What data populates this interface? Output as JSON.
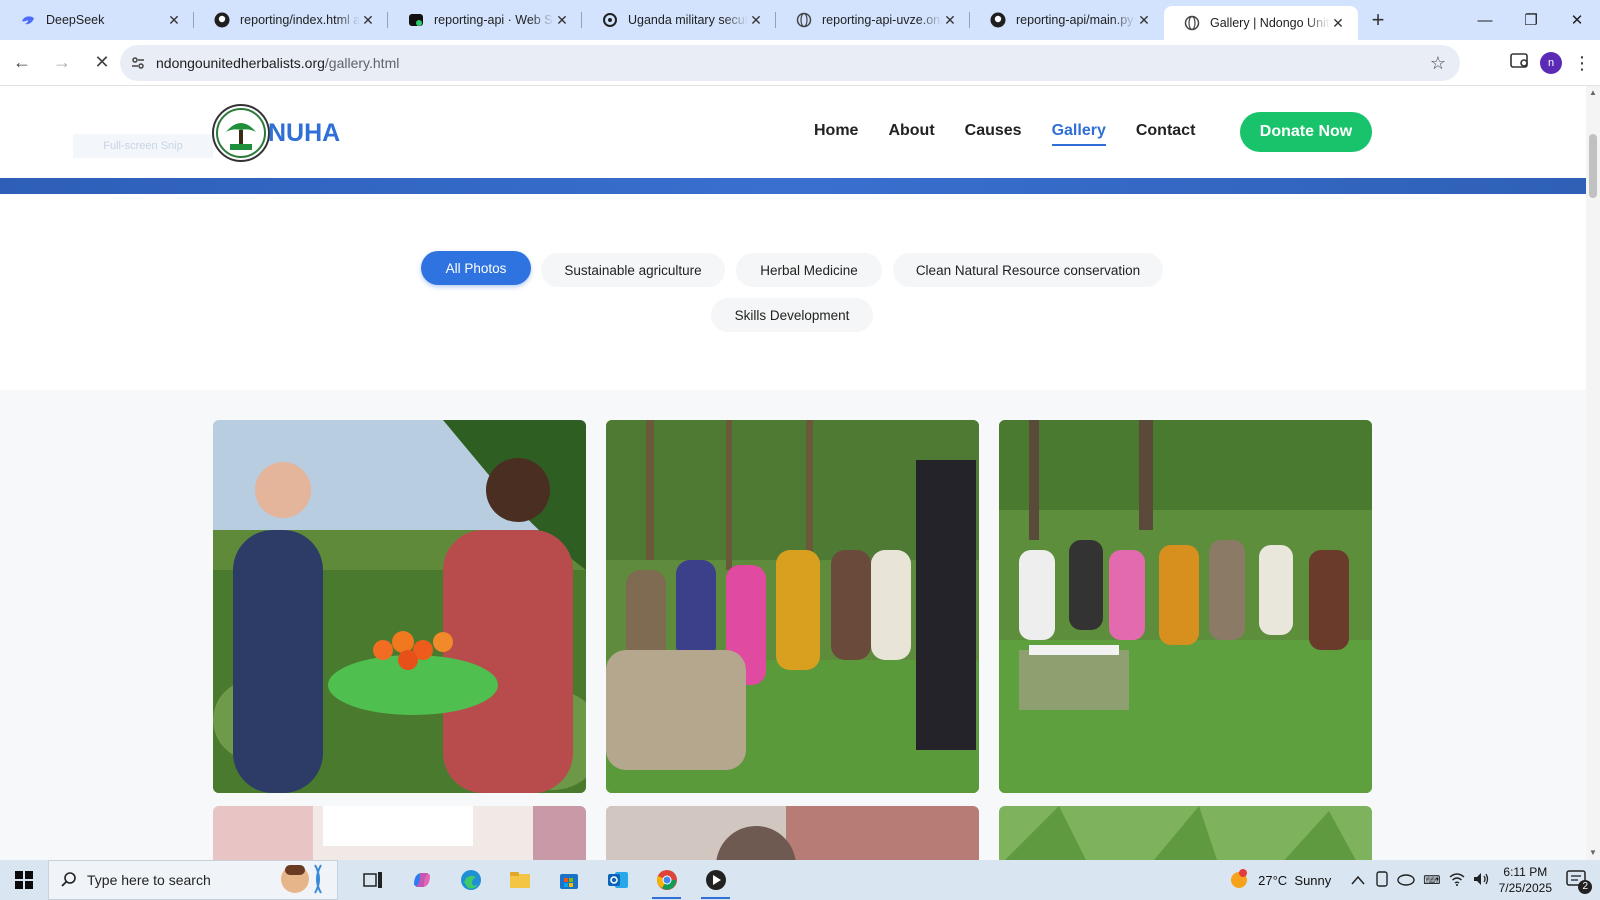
{
  "browser": {
    "tabs": [
      {
        "title": "DeepSeek",
        "icon": "deepseek-icon"
      },
      {
        "title": "reporting/index.html at",
        "icon": "github-icon"
      },
      {
        "title": "reporting-api · Web Se",
        "icon": "render-icon"
      },
      {
        "title": "Uganda military securit",
        "icon": "openai-icon"
      },
      {
        "title": "reporting-api-uvze.onr",
        "icon": "globe-icon"
      },
      {
        "title": "reporting-api/main.py",
        "icon": "github-icon"
      },
      {
        "title": "Gallery | Ndongo Unite",
        "icon": "globe-icon",
        "active": true
      }
    ],
    "url_host": "ndongounitedherbalists.org",
    "url_path": "/gallery.html",
    "profile_initial": "n"
  },
  "site": {
    "snip_label": "Full-screen Snip",
    "brand": "NUHA",
    "nav": [
      {
        "label": "Home"
      },
      {
        "label": "About"
      },
      {
        "label": "Causes"
      },
      {
        "label": "Gallery",
        "active": true
      },
      {
        "label": "Contact"
      }
    ],
    "donate_label": "Donate Now",
    "filters": [
      {
        "label": "All Photos",
        "active": true
      },
      {
        "label": "Sustainable agriculture"
      },
      {
        "label": "Herbal Medicine"
      },
      {
        "label": "Clean Natural Resource conservation"
      },
      {
        "label": "Skills Development"
      }
    ],
    "colors": {
      "accent": "#2f73e0",
      "donate": "#19c36b",
      "brand": "#2f6fd6"
    }
  },
  "taskbar": {
    "search_placeholder": "Type here to search",
    "weather": "27°C  Sunny",
    "time": "6:11 PM",
    "date": "7/25/2025",
    "notifications": "2"
  }
}
